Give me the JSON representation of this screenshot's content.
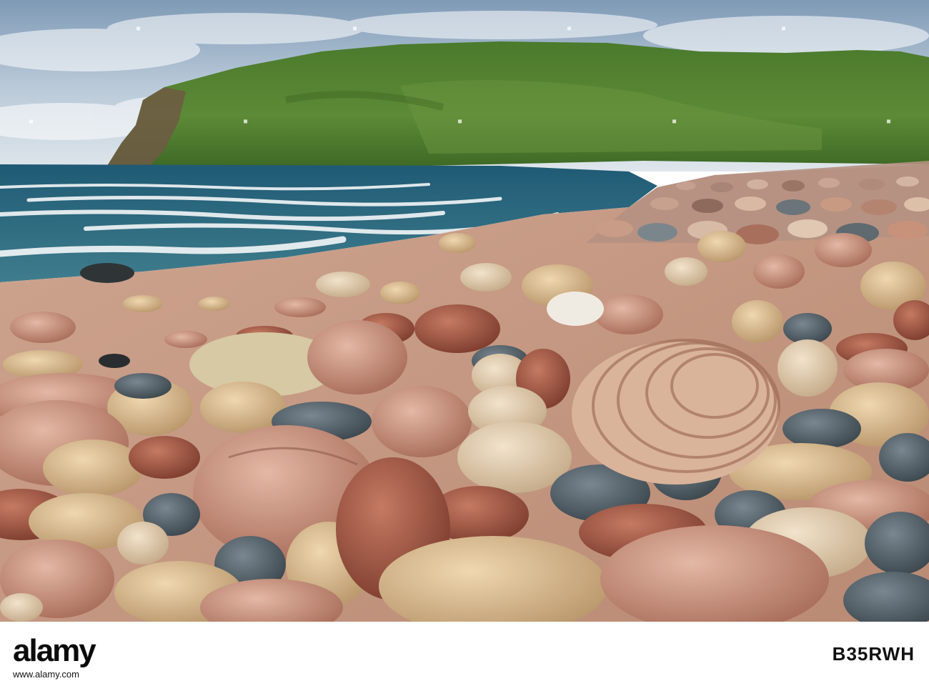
{
  "watermark": {
    "brand": "alamy",
    "site": "www.alamy.com",
    "image_code": "B35RWH"
  },
  "colors": {
    "sky": "#c9d6e2",
    "hill": "#4e7c2e",
    "sea": "#2a5f78",
    "sand": "#caa48a",
    "stone_pink": "#c8907a",
    "stone_grey": "#5d6a70"
  }
}
